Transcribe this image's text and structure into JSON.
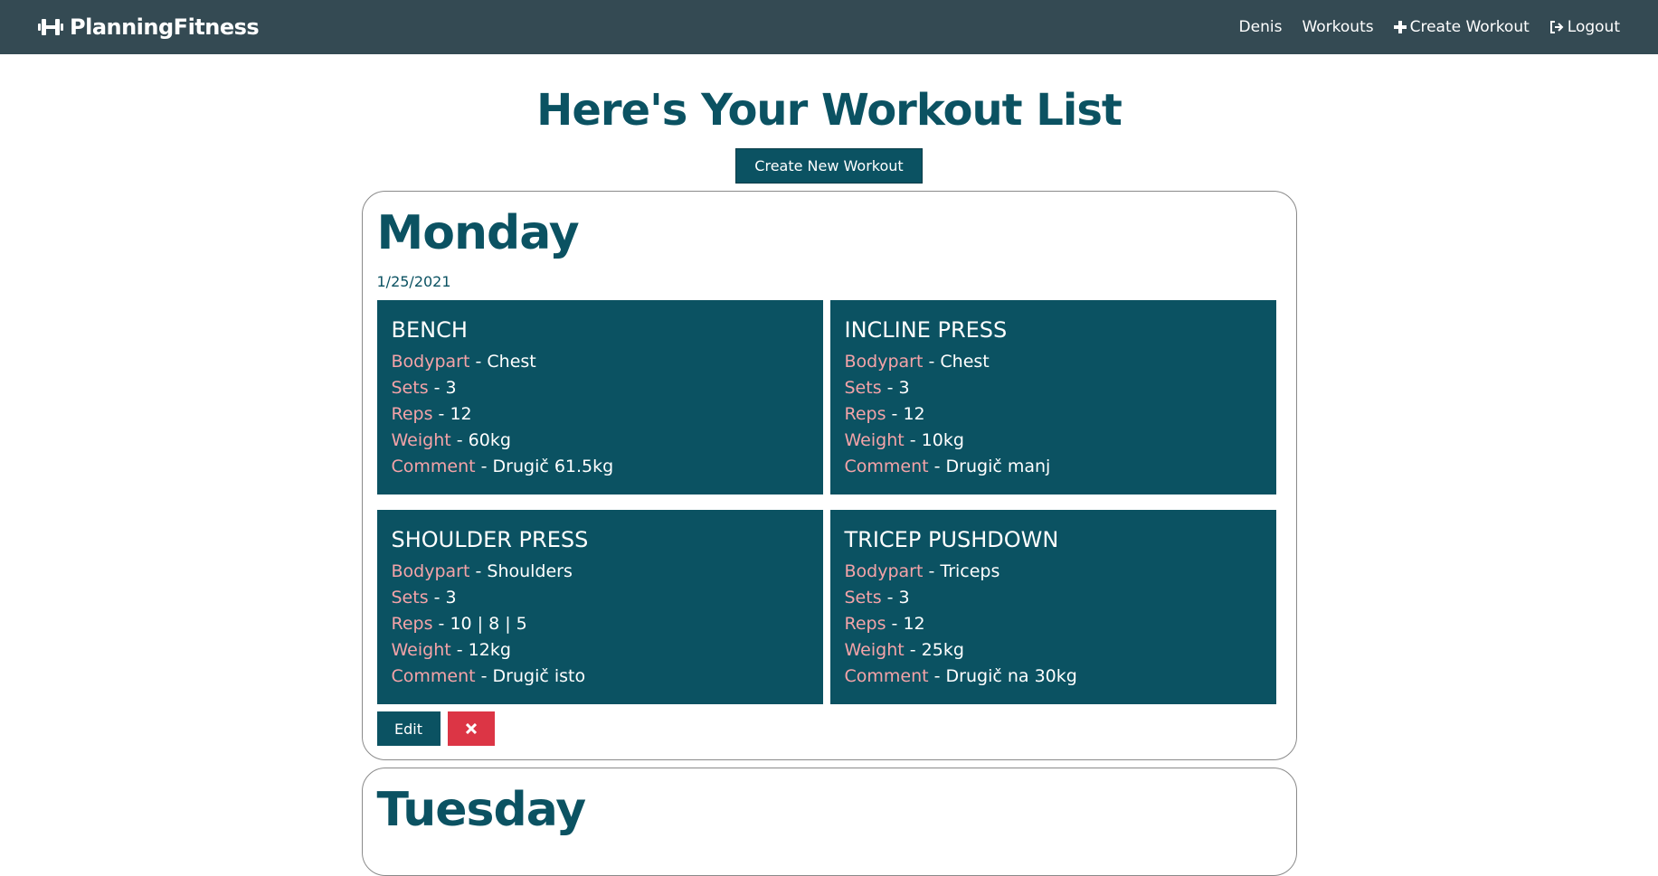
{
  "nav": {
    "brand": "PlanningFitness",
    "links": [
      {
        "label": "Denis"
      },
      {
        "label": "Workouts"
      },
      {
        "label": "Create Workout",
        "icon": "plus-icon"
      },
      {
        "label": "Logout",
        "icon": "sign-out-icon"
      }
    ]
  },
  "page": {
    "title": "Here's Your Workout List",
    "create_button": "Create New Workout"
  },
  "labels": {
    "bodypart": "Bodypart",
    "sets": "Sets",
    "reps": "Reps",
    "weight": "Weight",
    "comment": "Comment"
  },
  "days": [
    {
      "name": "Monday",
      "date": "1/25/2021",
      "exercises": [
        {
          "name": "BENCH",
          "bodypart": "- Chest",
          "sets": "- 3",
          "reps": "- 12",
          "weight": "- 60kg",
          "comment": "- Drugič 61.5kg"
        },
        {
          "name": "INCLINE PRESS",
          "bodypart": "- Chest",
          "sets": "- 3",
          "reps": "- 12",
          "weight": "- 10kg",
          "comment": "- Drugič manj"
        },
        {
          "name": "SHOULDER PRESS",
          "bodypart": "- Shoulders",
          "sets": "- 3",
          "reps": "- 10 | 8 | 5",
          "weight": "- 12kg",
          "comment": "- Drugič isto"
        },
        {
          "name": "TRICEP PUSHDOWN",
          "bodypart": "- Triceps",
          "sets": "- 3",
          "reps": "- 12",
          "weight": "- 25kg",
          "comment": "- Drugič na 30kg"
        }
      ],
      "edit_label": "Edit"
    },
    {
      "name": "Tuesday"
    }
  ],
  "colors": {
    "navbar": "#344a53",
    "primary": "#0b5262",
    "label": "#f4a3a8",
    "danger": "#dc3545"
  }
}
